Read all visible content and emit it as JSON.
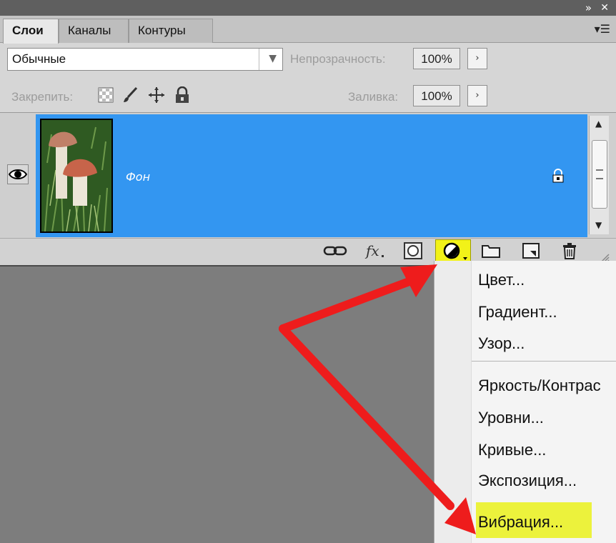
{
  "window": {
    "collapse_icon": "double-chevron-right-icon",
    "close_icon": "close-icon"
  },
  "tabs": [
    {
      "label": "Слои",
      "active": true
    },
    {
      "label": "Каналы",
      "active": false
    },
    {
      "label": "Контуры",
      "active": false
    }
  ],
  "panel_menu_icon": "panel-menu-icon",
  "blend_mode": {
    "value": "Обычные"
  },
  "opacity": {
    "label": "Непрозрачность:",
    "value": "100%",
    "arrow": "›"
  },
  "lock": {
    "label": "Закрепить:",
    "icons": [
      "lock-transparent-icon",
      "lock-paint-icon",
      "lock-position-icon",
      "lock-all-icon"
    ]
  },
  "fill": {
    "label": "Заливка:",
    "value": "100%",
    "arrow": "›"
  },
  "layers": [
    {
      "name": "Фон",
      "visible": true,
      "selected": true,
      "locked": true
    }
  ],
  "bottom_icons": [
    "link-icon",
    "fx-icon",
    "mask-icon",
    "adjustment-layer-icon",
    "folder-icon",
    "new-layer-icon",
    "trash-icon"
  ],
  "menu": {
    "group1": [
      "Цвет...",
      "Градиент...",
      "Узор..."
    ],
    "group2": [
      "Яркость/Контрас",
      "Уровни...",
      "Кривые...",
      "Экспозиция...",
      "Вибрация..."
    ],
    "highlighted": "Вибрация..."
  },
  "colors": {
    "selection": "#3396f1",
    "highlight": "#f2f218",
    "annotation_arrow": "#ee1c1c"
  }
}
